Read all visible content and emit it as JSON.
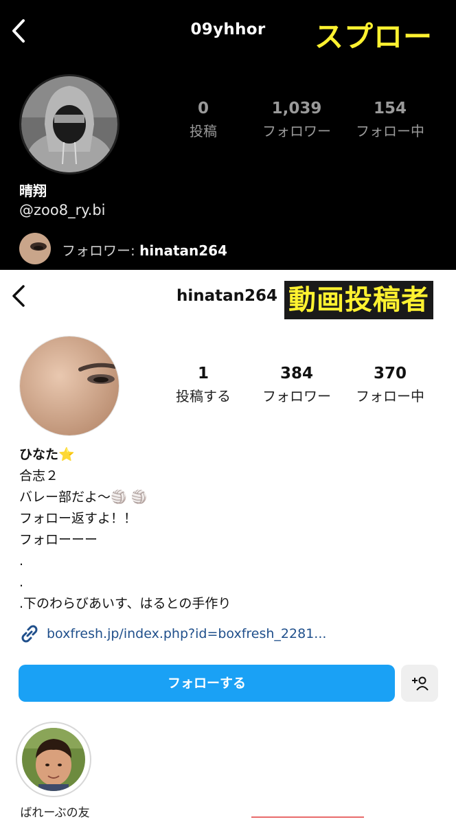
{
  "top_profile": {
    "username": "09yhhor",
    "tag": "スプロー",
    "stats": [
      {
        "value": "0",
        "label": "投稿"
      },
      {
        "value": "1,039",
        "label": "フォロワー"
      },
      {
        "value": "154",
        "label": "フォロー中"
      }
    ],
    "display_name": "晴翔",
    "handle": "@zoo8_ry.bi",
    "followed_by_prefix": "フォロワー: ",
    "followed_by_user": "hinatan264"
  },
  "bottom_profile": {
    "username": "hinatan264",
    "tag": "動画投稿者",
    "stats": [
      {
        "value": "1",
        "label": "投稿する"
      },
      {
        "value": "384",
        "label": "フォロワー"
      },
      {
        "value": "370",
        "label": "フォロー中"
      }
    ],
    "display_name": "ひなた⭐",
    "bio_lines": [
      "合志２",
      "バレー部だよ〜🏐 🏐",
      "フォロー返すよ！！",
      "フォローーー",
      ".",
      ".",
      ".下のわらびあいす、はるとの手作り"
    ],
    "link": "boxfresh.jp/index.php?id=boxfresh_2281...",
    "follow_button": "フォローする",
    "highlight_label": "ばれーぶの友"
  },
  "colors": {
    "tag_yellow": "#fff230",
    "follow_blue": "#1aa1f5",
    "link_blue": "#1f4f8b"
  }
}
